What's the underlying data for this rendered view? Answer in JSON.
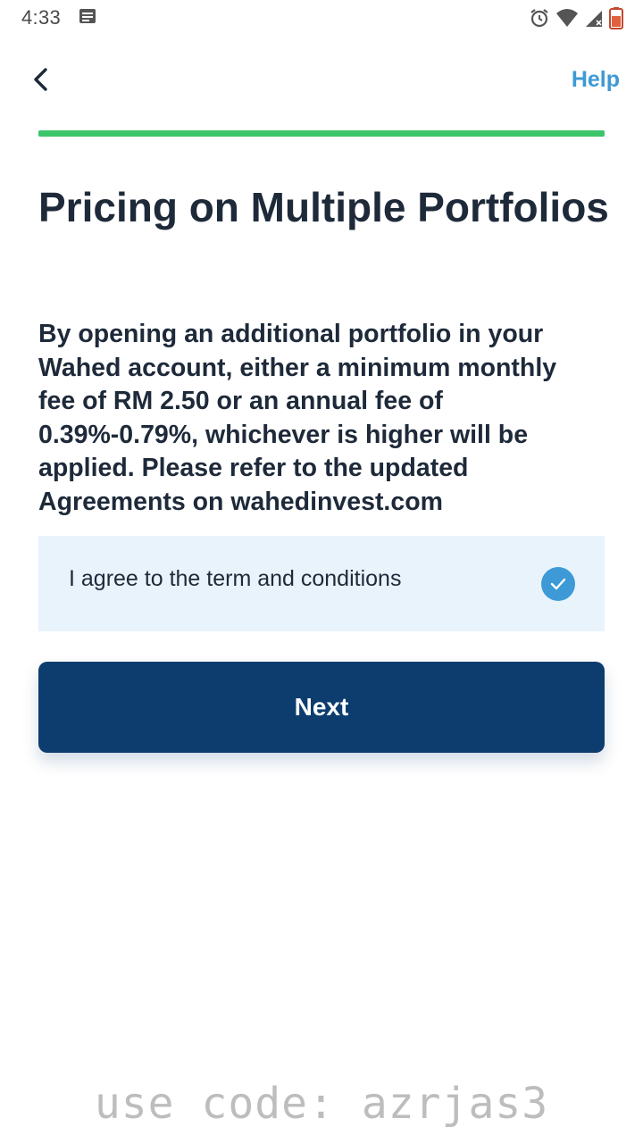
{
  "status_bar": {
    "time": "4:33",
    "notification_icon": "message-icon",
    "right_icons": [
      "alarm-icon",
      "wifi-icon",
      "signal-icon",
      "battery-icon"
    ]
  },
  "app_bar": {
    "back_icon": "chevron-left-icon",
    "help_label": "Help"
  },
  "progress": {
    "fraction": 1.0,
    "color": "#3cc46a"
  },
  "content": {
    "title": "Pricing on Multiple Portfolios",
    "description": "By opening an additional portfolio in your Wahed account, either a minimum monthly fee of RM 2.50 or an annual fee of 0.39%-0.79%, whichever is higher will be applied. Please refer to the updated Agreements on wahedinvest.com"
  },
  "agreement": {
    "label": "I agree to the term and conditions",
    "checked": true,
    "check_icon": "check-circle-icon"
  },
  "next_button": {
    "label": "Next"
  },
  "watermark": {
    "text": "use code: azrjas3"
  },
  "colors": {
    "primary": "#0c3d6e",
    "accent": "#3d9ad6",
    "success": "#3cc46a",
    "card_bg": "#e9f3fb",
    "text": "#1e2a3a"
  }
}
